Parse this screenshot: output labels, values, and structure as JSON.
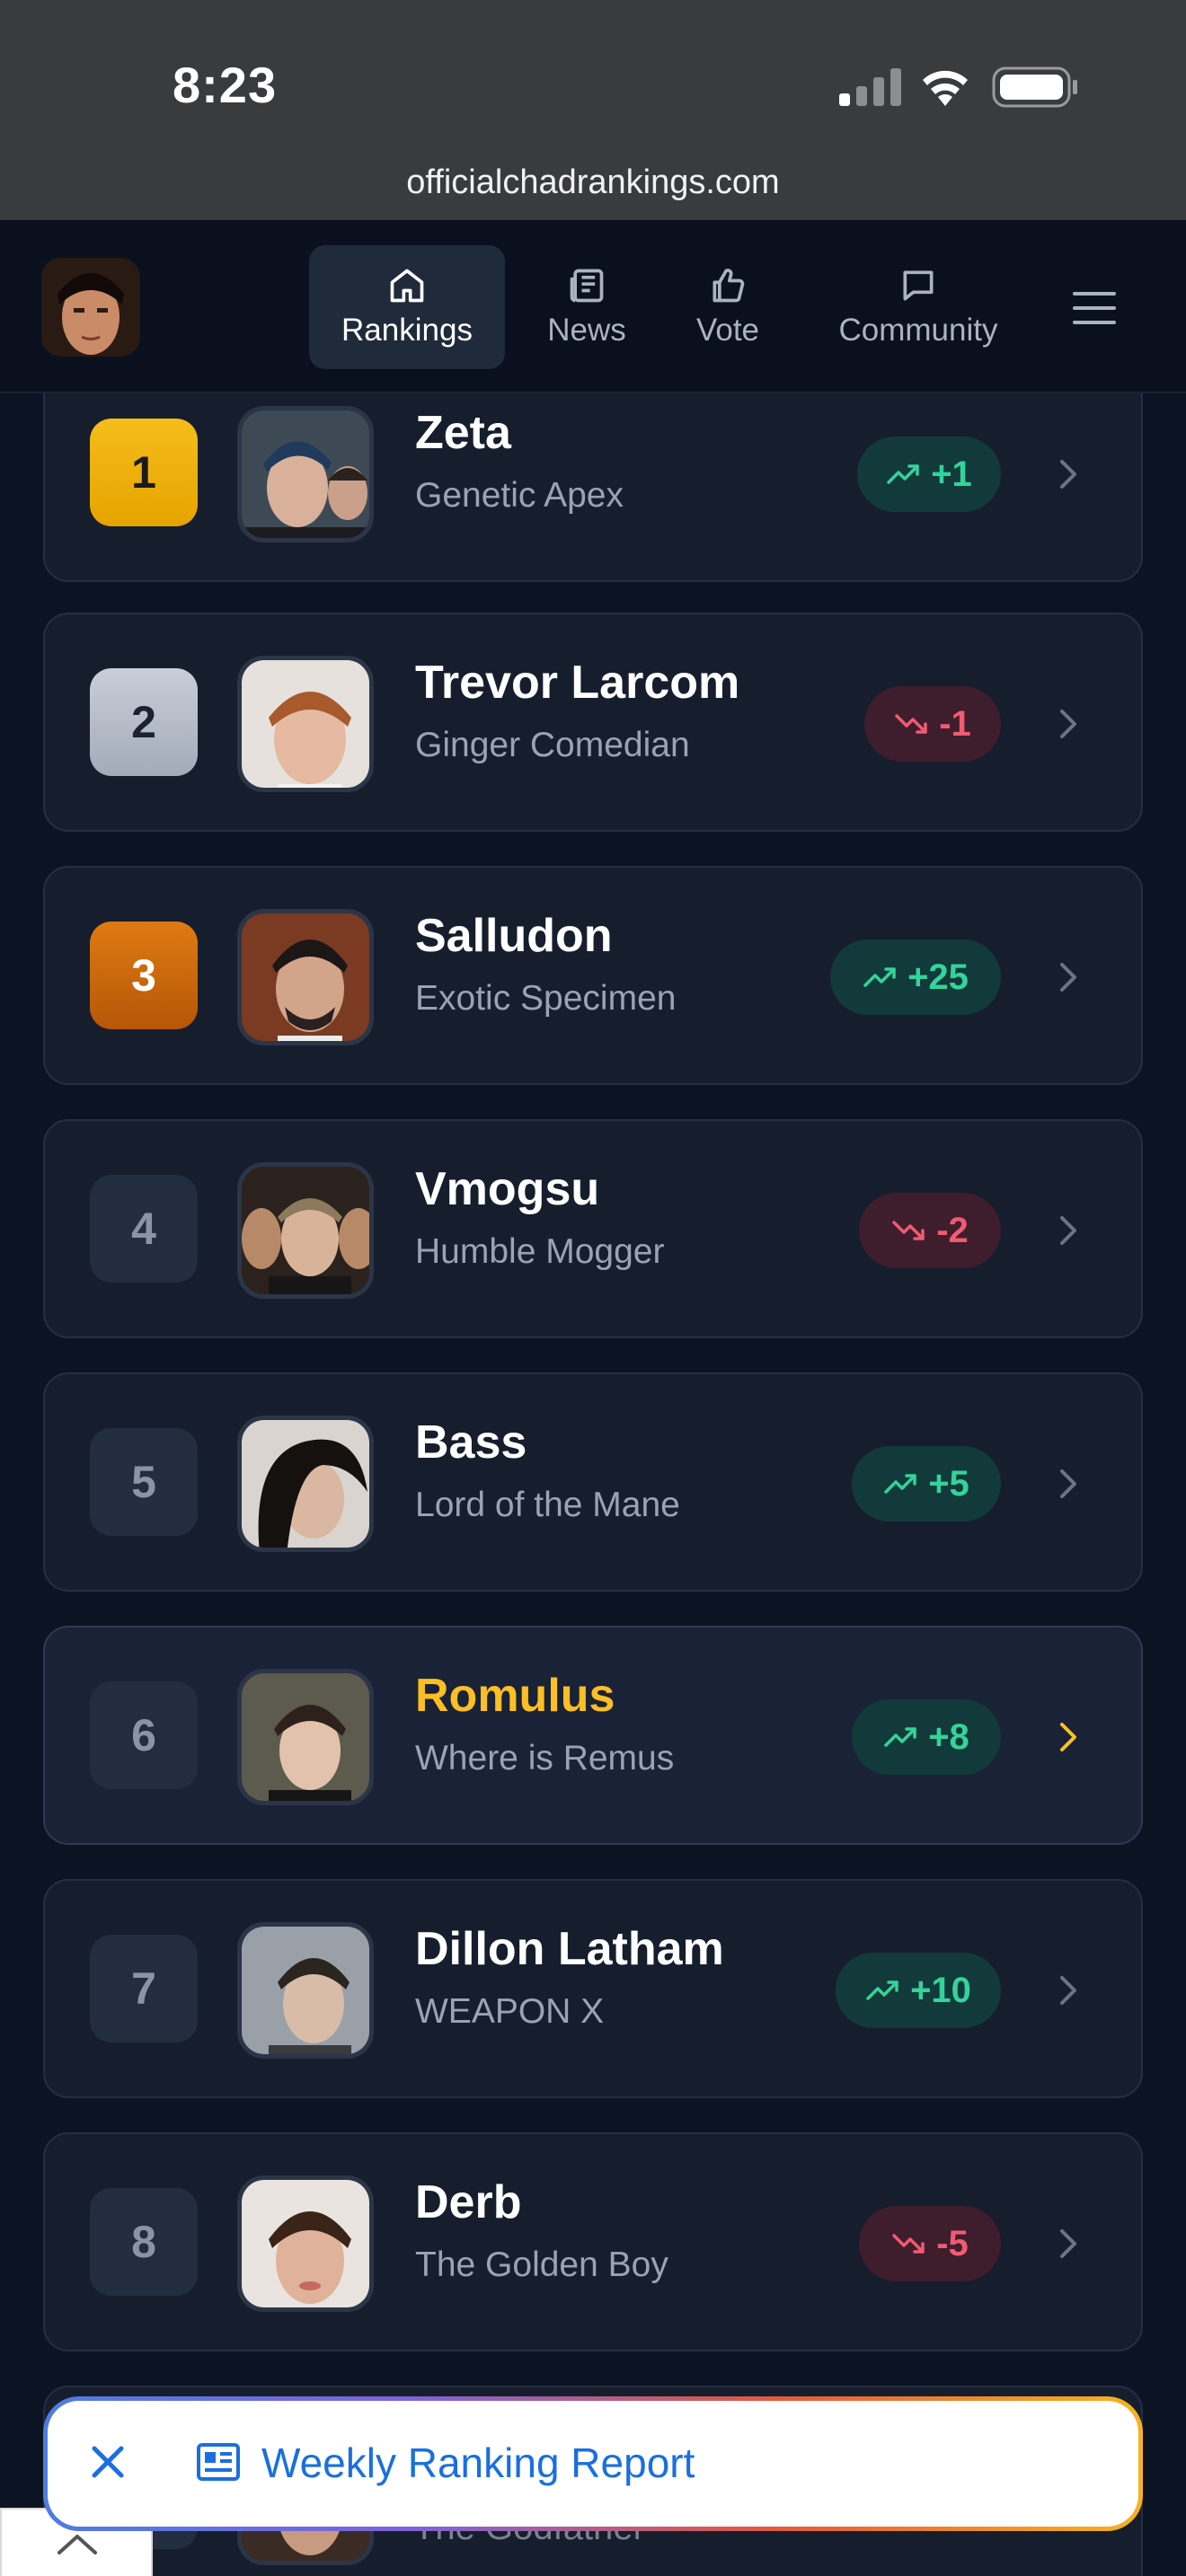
{
  "status_bar": {
    "time": "8:23"
  },
  "browser": {
    "url": "officialchadrankings.com"
  },
  "nav": {
    "items": [
      {
        "label": "Rankings",
        "icon": "home-icon",
        "active": true
      },
      {
        "label": "News",
        "icon": "newspaper-icon",
        "active": false
      },
      {
        "label": "Vote",
        "icon": "thumbs-up-icon",
        "active": false
      },
      {
        "label": "Community",
        "icon": "chat-icon",
        "active": false
      }
    ]
  },
  "rankings": [
    {
      "rank": "1",
      "name": "Zeta",
      "title": "Genetic Apex",
      "change": "+1",
      "trend": "up",
      "tier": "gold"
    },
    {
      "rank": "2",
      "name": "Trevor Larcom",
      "title": "Ginger Comedian",
      "change": "-1",
      "trend": "down",
      "tier": "silver"
    },
    {
      "rank": "3",
      "name": "Salludon",
      "title": "Exotic Specimen",
      "change": "+25",
      "trend": "up",
      "tier": "bronze"
    },
    {
      "rank": "4",
      "name": "Vmogsu",
      "title": "Humble Mogger",
      "change": "-2",
      "trend": "down",
      "tier": ""
    },
    {
      "rank": "5",
      "name": "Bass",
      "title": "Lord of the Mane",
      "change": "+5",
      "trend": "up",
      "tier": ""
    },
    {
      "rank": "6",
      "name": "Romulus",
      "title": "Where is Remus",
      "change": "+8",
      "trend": "up",
      "tier": "",
      "highlight": true
    },
    {
      "rank": "7",
      "name": "Dillon Latham",
      "title": "WEAPON X",
      "change": "+10",
      "trend": "up",
      "tier": ""
    },
    {
      "rank": "8",
      "name": "Derb",
      "title": "The Golden Boy",
      "change": "-5",
      "trend": "down",
      "tier": ""
    }
  ],
  "peek_row": {
    "title": "The Godfather"
  },
  "banner": {
    "label": "Weekly Ranking Report"
  },
  "colors": {
    "background": "#0c1322",
    "card": "#161d2d",
    "gold": "#fbbf24",
    "up": "#34d399",
    "down": "#f05a72",
    "link": "#1a6fe0"
  }
}
